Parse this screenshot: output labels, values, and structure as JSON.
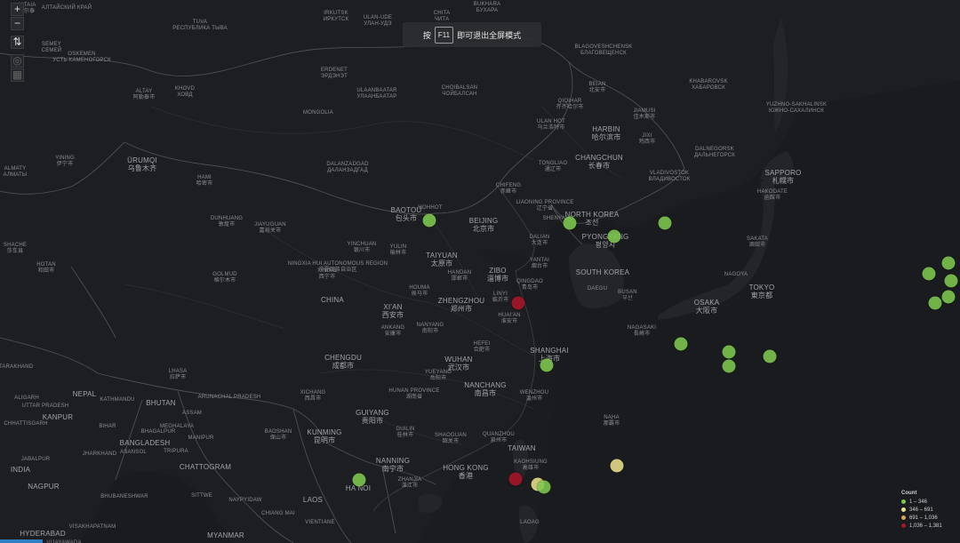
{
  "banner": {
    "prefix": "按",
    "key": "F11",
    "suffix": "即可退出全屏模式"
  },
  "zoom": {
    "in": "+",
    "out": "−"
  },
  "legend": {
    "title": "Count",
    "items": [
      {
        "label": "1 – 346",
        "color": "#7ec850"
      },
      {
        "label": "346 – 691",
        "color": "#e8e08a"
      },
      {
        "label": "691 – 1,036",
        "color": "#d8a25a"
      },
      {
        "label": "1,036 – 1,381",
        "color": "#a8162a"
      }
    ]
  },
  "places": [
    {
      "en": "ALTAIA",
      "cn": "阿尔泰"
    },
    {
      "en": "АЛТАЙСКИЙ КРАЙ",
      "cn": ""
    },
    {
      "en": "IRKUTSK",
      "cn": "ИРКУТСК"
    },
    {
      "en": "ULAN-UDE",
      "cn": "УЛАН-УДЭ"
    },
    {
      "en": "CHITA",
      "cn": "ЧИТА"
    },
    {
      "en": "BUKHARA",
      "cn": "БУХАРА"
    },
    {
      "en": "TUVA",
      "cn": "РЕСПУБЛИКА ТЫВА"
    },
    {
      "en": "SEMEY",
      "cn": "СЕМЕЙ"
    },
    {
      "en": "OSKEMEN",
      "cn": "УСТЬ-КАМЕНОГОРСК"
    },
    {
      "en": "ERDENET",
      "cn": "ЭРДЭНЭТ"
    },
    {
      "en": "BLAGOVESHCHENSK",
      "cn": "БЛАГОВЕЩЕНСК"
    },
    {
      "en": "ALTAY",
      "cn": "阿勒泰市"
    },
    {
      "en": "KHOVD",
      "cn": "ХОВД"
    },
    {
      "en": "CHOIBALSAN",
      "cn": "ЧОЙБАЛСАН"
    },
    {
      "en": "ULAANBAATAR",
      "cn": "УЛААНБААТАР"
    },
    {
      "en": "BEIAN",
      "cn": "北安市"
    },
    {
      "en": "KHABAROVSK",
      "cn": "ХАБАРОВСК"
    },
    {
      "en": "QIQIHAR",
      "cn": "齐齐哈尔市"
    },
    {
      "en": "MONGOLIA",
      "cn": ""
    },
    {
      "en": "JIAMUSI",
      "cn": "佳木斯市"
    },
    {
      "en": "YUZHNO-SAKHALINSK",
      "cn": "ЮЖНО-САХАЛИНСК"
    },
    {
      "en": "ULAN HOT",
      "cn": "乌兰浩特市"
    },
    {
      "en": "HARBIN",
      "cn": "哈尔滨市"
    },
    {
      "en": "JIXI",
      "cn": "鸡西市"
    },
    {
      "en": "DALNEGORSK",
      "cn": "ДАЛЬНЕГОРСК"
    },
    {
      "en": "YINING",
      "cn": "伊宁市"
    },
    {
      "en": "ÜRUMQI",
      "cn": "乌鲁木齐"
    },
    {
      "en": "CHANGCHUN",
      "cn": "长春市"
    },
    {
      "en": "ALMATY",
      "cn": "АЛМАТЫ"
    },
    {
      "en": "TONGLIAO",
      "cn": "通辽市"
    },
    {
      "en": "DALANZADGAD",
      "cn": "ДАЛАНЗАДГАД"
    },
    {
      "en": "VLADIVOSTOK",
      "cn": "ВЛАДИВОСТОК"
    },
    {
      "en": "SAPPORO",
      "cn": "札幌市"
    },
    {
      "en": "HAMI",
      "cn": "哈密市"
    },
    {
      "en": "CHIFENG",
      "cn": "赤峰市"
    },
    {
      "en": "HAKODATE",
      "cn": "函館市"
    },
    {
      "en": "LIAONING PROVINCE",
      "cn": "辽宁省"
    },
    {
      "en": "BAOTOU",
      "cn": "包头市"
    },
    {
      "en": "HOHHOT",
      "cn": ""
    },
    {
      "en": "BEIJING",
      "cn": "北京市"
    },
    {
      "en": "DUNHUANG",
      "cn": "敦煌市"
    },
    {
      "en": "JIAYUGUAN",
      "cn": "嘉峪关市"
    },
    {
      "en": "SHENYANG",
      "cn": ""
    },
    {
      "en": "NORTH KOREA",
      "cn": "조선"
    },
    {
      "en": "PYONGYANG",
      "cn": "평양시"
    },
    {
      "en": "SAKATA",
      "cn": "酒田市"
    },
    {
      "en": "DALIAN",
      "cn": "大连市"
    },
    {
      "en": "YINCHUAN",
      "cn": "银川市"
    },
    {
      "en": "YULIN",
      "cn": "榆林市"
    },
    {
      "en": "TAIYUAN",
      "cn": "太原市"
    },
    {
      "en": "SHACHE",
      "cn": "莎车县"
    },
    {
      "en": "HOTAN",
      "cn": "和田市"
    },
    {
      "en": "NINGXIA HUI AUTONOMOUS REGION",
      "cn": "宁夏回族自治区"
    },
    {
      "en": "XINING",
      "cn": "西宁市"
    },
    {
      "en": "GOLMUD",
      "cn": "格尔木市"
    },
    {
      "en": "HANDAN",
      "cn": "邯郸市"
    },
    {
      "en": "ZIBO",
      "cn": "淄博市"
    },
    {
      "en": "YANTAI",
      "cn": "烟台市"
    },
    {
      "en": "QINGDAO",
      "cn": "青岛市"
    },
    {
      "en": "SOUTH KOREA",
      "cn": ""
    },
    {
      "en": "DAEGU",
      "cn": ""
    },
    {
      "en": "BUSAN",
      "cn": "부산"
    },
    {
      "en": "OSAKA",
      "cn": "大阪市"
    },
    {
      "en": "NAGOYA",
      "cn": ""
    },
    {
      "en": "TOKYO",
      "cn": "東京都"
    },
    {
      "en": "CHINA",
      "cn": ""
    },
    {
      "en": "HOUMA",
      "cn": "侯马市"
    },
    {
      "en": "ZHENGZHOU",
      "cn": "郑州市"
    },
    {
      "en": "LINYI",
      "cn": "临沂市"
    },
    {
      "en": "XI'AN",
      "cn": "西安市"
    },
    {
      "en": "ANKANG",
      "cn": "安康市"
    },
    {
      "en": "NANYANG",
      "cn": "南阳市"
    },
    {
      "en": "HUAI'AN",
      "cn": "淮安市"
    },
    {
      "en": "HEFEI",
      "cn": "合肥市"
    },
    {
      "en": "SHANGHAI",
      "cn": "上海市"
    },
    {
      "en": "NAGASAKI",
      "cn": "長崎市"
    },
    {
      "en": "CHENGDU",
      "cn": "成都市"
    },
    {
      "en": "WUHAN",
      "cn": "武汉市"
    },
    {
      "en": "YUEYANG",
      "cn": "岳阳市"
    },
    {
      "en": "NANCHANG",
      "cn": "南昌市"
    },
    {
      "en": "HUNAN PROVINCE",
      "cn": "湖南省"
    },
    {
      "en": "WENZHOU",
      "cn": "温州市"
    },
    {
      "en": "LHASA",
      "cn": "拉萨市"
    },
    {
      "en": "XICHANG",
      "cn": "西昌市"
    },
    {
      "en": "ARUNACHAL PRADESH",
      "cn": ""
    },
    {
      "en": "KATHMANDU",
      "cn": ""
    },
    {
      "en": "BHUTAN",
      "cn": ""
    },
    {
      "en": "NEPAL",
      "cn": ""
    },
    {
      "en": "ASSAM",
      "cn": ""
    },
    {
      "en": "UTTAR PRADESH",
      "cn": ""
    },
    {
      "en": "KANPUR",
      "cn": ""
    },
    {
      "en": "BIHAR",
      "cn": ""
    },
    {
      "en": "MEGHALAYA",
      "cn": ""
    },
    {
      "en": "BHAGALPUR",
      "cn": ""
    },
    {
      "en": "BANGLADESH",
      "cn": ""
    },
    {
      "en": "MANIPUR",
      "cn": ""
    },
    {
      "en": "JHARKHAND",
      "cn": ""
    },
    {
      "en": "ASANSOL",
      "cn": ""
    },
    {
      "en": "TRIPURA",
      "cn": ""
    },
    {
      "en": "CHATTOGRAM",
      "cn": ""
    },
    {
      "en": "GUIYANG",
      "cn": "贵阳市"
    },
    {
      "en": "KUNMING",
      "cn": "昆明市"
    },
    {
      "en": "BAOSHAN",
      "cn": "保山市"
    },
    {
      "en": "GUILIN",
      "cn": "桂林市"
    },
    {
      "en": "SHAOGUAN",
      "cn": "韶关市"
    },
    {
      "en": "QUANZHOU",
      "cn": "泉州市"
    },
    {
      "en": "TAIWAN",
      "cn": ""
    },
    {
      "en": "KAOHSIUNG",
      "cn": "高雄市"
    },
    {
      "en": "NANNING",
      "cn": "南宁市"
    },
    {
      "en": "HONG KONG",
      "cn": "香港"
    },
    {
      "en": "ZHANJIA",
      "cn": "湛江市"
    },
    {
      "en": "HA NOI",
      "cn": ""
    },
    {
      "en": "LAOS",
      "cn": ""
    },
    {
      "en": "SITTWE",
      "cn": ""
    },
    {
      "en": "NAYPYIDAW",
      "cn": ""
    },
    {
      "en": "CHIANG MAI",
      "cn": ""
    },
    {
      "en": "VIENTIANE",
      "cn": ""
    },
    {
      "en": "MYANMAR",
      "cn": ""
    },
    {
      "en": "LAOAG",
      "cn": ""
    },
    {
      "en": "NAHA",
      "cn": "那覇市"
    },
    {
      "en": "INDIA",
      "cn": ""
    },
    {
      "en": "NAGPUR",
      "cn": ""
    },
    {
      "en": "HYDERABAD",
      "cn": ""
    },
    {
      "en": "JABALPUR",
      "cn": ""
    },
    {
      "en": "CHHATTISGARH",
      "cn": ""
    },
    {
      "en": "UTTARAKHAND",
      "cn": ""
    },
    {
      "en": "ALIGARH",
      "cn": ""
    },
    {
      "en": "BHUBANESHWAR",
      "cn": ""
    },
    {
      "en": "VISAKHAPATNAM",
      "cn": ""
    },
    {
      "en": "VIJAYAWADA",
      "cn": ""
    }
  ],
  "points": [
    {
      "lon": 110.6,
      "lat": 40.4,
      "count": 120
    },
    {
      "lon": 115.0,
      "lat": 40.2,
      "count": 90
    },
    {
      "lon": 116.4,
      "lat": 39.3,
      "count": 150
    },
    {
      "lon": 118.0,
      "lat": 40.2,
      "count": 60
    },
    {
      "lon": 113.4,
      "lat": 34.8,
      "count": 1380
    },
    {
      "lon": 118.5,
      "lat": 32.0,
      "count": 110
    },
    {
      "lon": 120.0,
      "lat": 31.5,
      "count": 140
    },
    {
      "lon": 121.3,
      "lat": 31.2,
      "count": 80
    },
    {
      "lon": 120.0,
      "lat": 30.5,
      "count": 70
    },
    {
      "lon": 114.3,
      "lat": 30.6,
      "count": 200
    },
    {
      "lon": 116.5,
      "lat": 23.8,
      "count": 520
    },
    {
      "lon": 113.3,
      "lat": 22.9,
      "count": 1250
    },
    {
      "lon": 114.0,
      "lat": 22.5,
      "count": 420
    },
    {
      "lon": 114.2,
      "lat": 22.3,
      "count": 330
    },
    {
      "lon": 108.4,
      "lat": 22.8,
      "count": 90
    },
    {
      "lon": 126.9,
      "lat": 37.5,
      "count": 100
    },
    {
      "lon": 126.3,
      "lat": 36.8,
      "count": 120
    },
    {
      "lon": 127.0,
      "lat": 36.3,
      "count": 90
    },
    {
      "lon": 128.6,
      "lat": 35.9,
      "count": 80
    },
    {
      "lon": 129.0,
      "lat": 35.1,
      "count": 75
    },
    {
      "lon": 126.9,
      "lat": 35.2,
      "count": 60
    },
    {
      "lon": 126.5,
      "lat": 34.8,
      "count": 55
    },
    {
      "lon": 135.5,
      "lat": 34.7,
      "count": 80
    },
    {
      "lon": 136.9,
      "lat": 35.2,
      "count": 70
    },
    {
      "lon": 135.0,
      "lat": 34.2,
      "count": 60
    },
    {
      "lon": 133.8,
      "lat": 33.8,
      "count": 55
    },
    {
      "lon": 139.7,
      "lat": 35.7,
      "count": 160
    },
    {
      "lon": 140.4,
      "lat": 35.2,
      "count": 120
    },
    {
      "lon": 140.9,
      "lat": 38.3,
      "count": 70
    }
  ]
}
